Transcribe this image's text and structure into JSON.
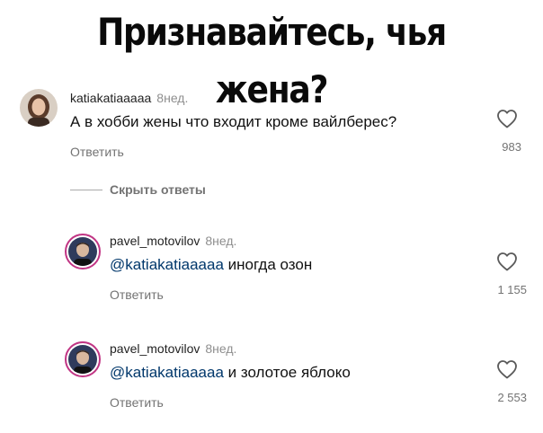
{
  "headline": "Признавайтесь, чья жена?",
  "colors": {
    "mention": "#00376b",
    "meta": "#737373",
    "story_ring": "#c13584"
  },
  "comments": [
    {
      "username": "katiakatiaaaaa",
      "time": "8нед.",
      "text": "А в хобби жены что входит кроме вайлберес?",
      "reply_label": "Ответить",
      "likes": "983",
      "icons": [
        "avatar",
        "heart-icon"
      ]
    },
    {
      "username": "pavel_motovilov",
      "time": "8нед.",
      "mention": "@katiakatiaaaaa",
      "text": "иногда озон",
      "reply_label": "Ответить",
      "likes": "1 155",
      "icons": [
        "avatar",
        "heart-icon"
      ]
    },
    {
      "username": "pavel_motovilov",
      "time": "8нед.",
      "mention": "@katiakatiaaaaa",
      "text": "и золотое яблоко",
      "reply_label": "Ответить",
      "likes": "2 553",
      "icons": [
        "avatar",
        "heart-icon"
      ]
    }
  ],
  "hide_replies_label": "Скрыть ответы"
}
